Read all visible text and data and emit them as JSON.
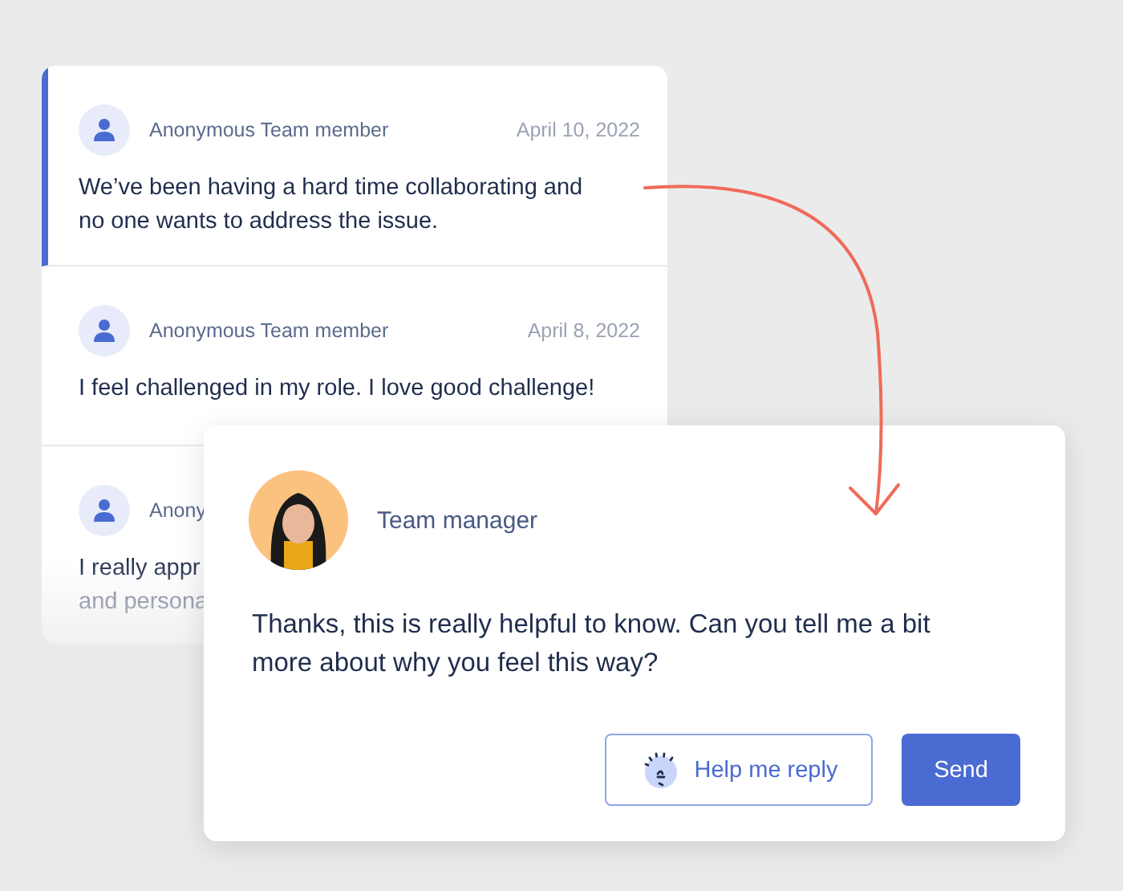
{
  "messages": [
    {
      "author": "Anonymous Team member",
      "date": "April 10, 2022",
      "lines": [
        "We’ve been having a hard time collaborating and",
        "no one wants to address the issue."
      ],
      "selected": true
    },
    {
      "author": "Anonymous Team member",
      "date": "April 8, 2022",
      "lines": [
        "I feel challenged in my role. I love good challenge!"
      ],
      "selected": false
    },
    {
      "author": "Anony",
      "lines": [
        "I really appr",
        "and persona"
      ],
      "selected": false
    }
  ],
  "reply": {
    "author": "Team manager",
    "text": "Thanks, this is really helpful to know. Can you tell me a bit more about why you feel this way?",
    "buttons": [
      {
        "label": "Help me reply",
        "kind": "secondary"
      },
      {
        "label": "Send",
        "kind": "primary"
      }
    ]
  }
}
